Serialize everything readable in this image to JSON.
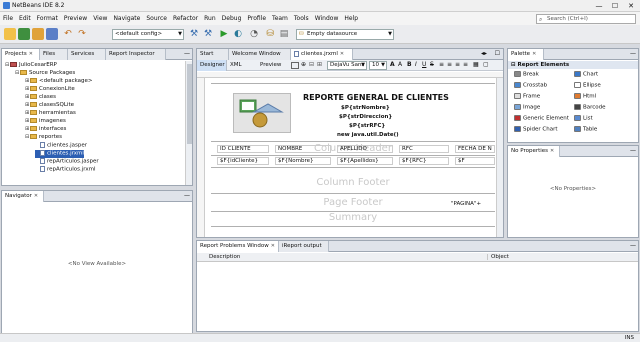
{
  "window": {
    "title": "NetBeans IDE 8.2",
    "minimize": "—",
    "maximize": "☐",
    "close": "✕"
  },
  "menu": [
    "File",
    "Edit",
    "Format",
    "Preview",
    "View",
    "Navigate",
    "Source",
    "Refactor",
    "Run",
    "Debug",
    "Profile",
    "Team",
    "Tools",
    "Window",
    "Help"
  ],
  "search": {
    "placeholder": "Search (Ctrl+I)"
  },
  "toolbar": {
    "config": "<default config>",
    "datasource": "Empty datasource"
  },
  "projects": {
    "tabs": [
      "Projects",
      "Files",
      "Services",
      "Report Inspector"
    ],
    "tree": [
      {
        "label": "JulioCesarERP",
        "depth": 0,
        "kind": "project",
        "exp": "⊟"
      },
      {
        "label": "Source Packages",
        "depth": 1,
        "kind": "folder",
        "exp": "⊟"
      },
      {
        "label": "<default package>",
        "depth": 2,
        "kind": "folder",
        "exp": "⊞"
      },
      {
        "label": "ConexionLite",
        "depth": 2,
        "kind": "folder",
        "exp": "⊞"
      },
      {
        "label": "clases",
        "depth": 2,
        "kind": "folder",
        "exp": "⊞"
      },
      {
        "label": "clasesSQLite",
        "depth": 2,
        "kind": "folder",
        "exp": "⊞"
      },
      {
        "label": "herramientas",
        "depth": 2,
        "kind": "folder",
        "exp": "⊞"
      },
      {
        "label": "imagenes",
        "depth": 2,
        "kind": "folder",
        "exp": "⊞"
      },
      {
        "label": "interfaces",
        "depth": 2,
        "kind": "folder",
        "exp": "⊞"
      },
      {
        "label": "reportes",
        "depth": 2,
        "kind": "folder",
        "exp": "⊟"
      },
      {
        "label": "clientes.jasper",
        "depth": 3,
        "kind": "file",
        "exp": ""
      },
      {
        "label": "clientes.jrxml",
        "depth": 3,
        "kind": "file",
        "exp": "",
        "selected": true
      },
      {
        "label": "repArticulos.jasper",
        "depth": 3,
        "kind": "file",
        "exp": ""
      },
      {
        "label": "repArticulos.jrxml",
        "depth": 3,
        "kind": "file",
        "exp": ""
      }
    ]
  },
  "navigator": {
    "title": "Navigator",
    "empty": "<No View Available>"
  },
  "editor": {
    "tabs": [
      "Start Page",
      "Welcome Window",
      "clientes.jrxml"
    ],
    "subtabs": [
      "Designer",
      "XML",
      "Preview"
    ],
    "font": "DejaVu Sans",
    "font_size": "10"
  },
  "report": {
    "title": "REPORTE GENERAL DE CLIENTES",
    "params": [
      "$P{strNombre}",
      "$P{strDireccion}",
      "$P{strRFC}",
      "new java.util.Date()"
    ],
    "headers": [
      "ID CLIENTE",
      "NOMBRE",
      "APELLIDO",
      "RFC",
      "FECHA DE N"
    ],
    "fields": [
      "$F{idCliente}",
      "$F{Nombre}",
      "$F{Apellidos}",
      "$F{RFC}",
      "$F"
    ],
    "bands": [
      "Column Header",
      "Column Footer",
      "Page Footer",
      "Summary"
    ],
    "page_expr": "\"PAGINA\"+"
  },
  "palette": {
    "title": "Palette",
    "section": "Report Elements",
    "items": [
      {
        "label": "Break",
        "color": "#888888"
      },
      {
        "label": "Chart",
        "color": "#3a78c8"
      },
      {
        "label": "Crosstab",
        "color": "#4a88d0"
      },
      {
        "label": "Ellipse",
        "color": "#ffffff"
      },
      {
        "label": "Frame",
        "color": "#dddddd"
      },
      {
        "label": "Html",
        "color": "#e07b30"
      },
      {
        "label": "Image",
        "color": "#7aa6d8"
      },
      {
        "label": "Barcode",
        "color": "#444444"
      },
      {
        "label": "Generic Element",
        "color": "#c03030"
      },
      {
        "label": "List",
        "color": "#5a8ad0"
      },
      {
        "label": "Spider Chart",
        "color": "#3060b0"
      },
      {
        "label": "Table",
        "color": "#5080c0"
      }
    ]
  },
  "properties": {
    "title": "No Properties",
    "empty": "<No Properties>"
  },
  "output": {
    "tabs": [
      "Report Problems Window",
      "iReport output"
    ],
    "columns": [
      "Description",
      "Object"
    ]
  },
  "status": {
    "mode": "INS"
  }
}
